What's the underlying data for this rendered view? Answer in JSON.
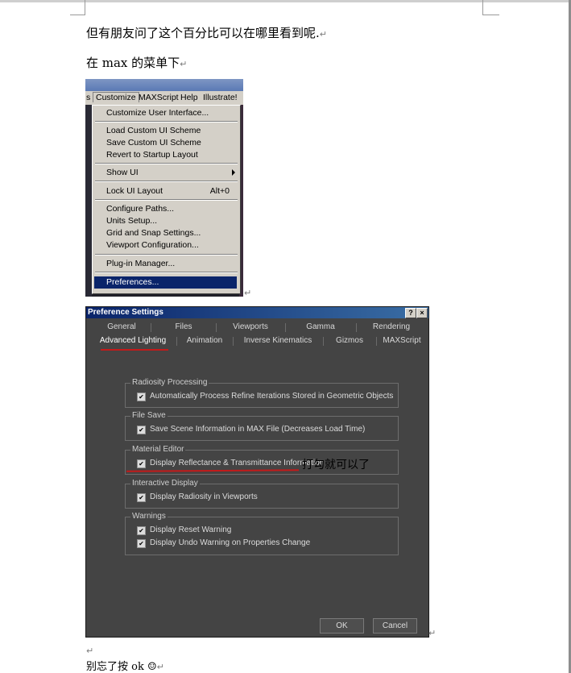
{
  "document": {
    "line1": "但有朋友问了这个百分比可以在哪里看到呢.",
    "line2": "在 max 的菜单下",
    "annotation": "打勾就可以了",
    "footer_blank_mark": "↵",
    "line_last": "别忘了按 ok ☺",
    "para_mark": "↵"
  },
  "menu": {
    "menubar": [
      "Customize",
      "MAXScript",
      "Help",
      "Illustrate!"
    ],
    "left_fragment": "s",
    "items": [
      {
        "label": "Customize User Interface..."
      },
      {
        "label": "Load Custom UI Scheme"
      },
      {
        "label": "Save Custom UI Scheme"
      },
      {
        "label": "Revert to Startup Layout"
      },
      {
        "label": "Show UI"
      },
      {
        "label": "Lock UI Layout",
        "shortcut": "Alt+0"
      },
      {
        "label": "Configure Paths..."
      },
      {
        "label": "Units Setup..."
      },
      {
        "label": "Grid and Snap Settings..."
      },
      {
        "label": "Viewport Configuration..."
      },
      {
        "label": "Plug-in Manager..."
      },
      {
        "label": "Preferences..."
      }
    ]
  },
  "dialog": {
    "title": "Preference Settings",
    "help_btn": "?",
    "close_btn": "×",
    "tabs_row1": [
      "General",
      "Files",
      "Viewports",
      "Gamma",
      "Rendering"
    ],
    "tabs_row2": [
      "Advanced Lighting",
      "Animation",
      "Inverse Kinematics",
      "Gizmos",
      "MAXScript"
    ],
    "groups": [
      {
        "title": "Radiosity Processing",
        "options": [
          "Automatically Process Refine Iterations Stored in Geometric Objects"
        ]
      },
      {
        "title": "File Save",
        "options": [
          "Save Scene Information in MAX File (Decreases Load Time)"
        ]
      },
      {
        "title": "Material Editor",
        "options": [
          "Display Reflectance & Transmittance Information"
        ]
      },
      {
        "title": "Interactive Display",
        "options": [
          "Display Radiosity in Viewports"
        ]
      },
      {
        "title": "Warnings",
        "options": [
          "Display Reset Warning",
          "Display Undo Warning on Properties Change"
        ]
      }
    ],
    "check_glyph": "✔",
    "ok": "OK",
    "cancel": "Cancel"
  },
  "colors": {
    "dialog_bg": "#444444",
    "menu_bg": "#d4d0c8",
    "highlight": "#0a246a",
    "annotation_red": "#c41a1a"
  }
}
